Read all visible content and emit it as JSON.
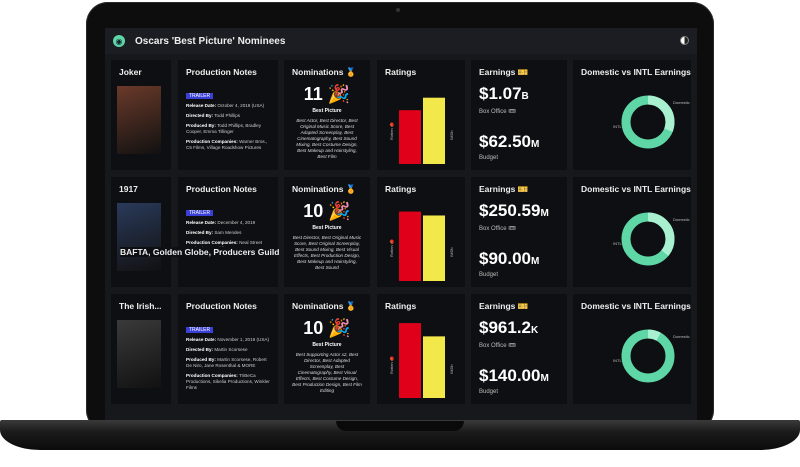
{
  "app": {
    "title": "Oscars 'Best Picture' Nominees"
  },
  "labels": {
    "production_notes": "Production Notes",
    "nominations": "Nominations 🏅",
    "ratings": "Ratings",
    "earnings": "Earnings 🎫",
    "domestic_vs_intl": "Domestic vs INTL Earnings",
    "trailer": "TRAILER",
    "box_office": "Box Office 🎟",
    "budget": "Budget",
    "release": "Release Date:",
    "directed": "Directed By:",
    "produced": "Produced By:",
    "companies": "Production Companies:",
    "rotten": "Rotten 🍅",
    "imdb": "IMDb",
    "domestic": "Domestic",
    "intl": "INTL"
  },
  "overlay": "BAFTA, Golden Globe, Producers Guild",
  "films": [
    {
      "title": "Joker",
      "release": "October 4, 2019 (USA)",
      "director": "Todd Phillips",
      "producers": "Todd Phillips, Bradley Cooper, Emma Tillinger",
      "companies": "Warner Bros., C5 Films, Village Roadshow Pictures",
      "nominations": "11 🎉",
      "win": "Best Picture",
      "nom_list": "Best Actor, Best Director, Best Original Music Score, Best Adapted Screenplay, Best Cinematography, Best Sound Mixing, Best Costume Design, Best Makeup and Hairstyling, Best Film",
      "box_office": "$1.07",
      "box_office_unit": "B",
      "budget": "$62.50",
      "budget_unit": "M",
      "rotten": 0.69,
      "imdb": 0.85,
      "domestic_share": 0.31,
      "poster": "#6a3a2a"
    },
    {
      "title": "1917",
      "release": "December 4, 2019",
      "director": "Sam Mendes",
      "producers": "",
      "companies": "Neal Street Productions, Amblin Partners & MORE",
      "nominations": "10 🎉",
      "win": "Best Picture",
      "nom_list": "Best Director, Best Original Music Score, Best Original Screenplay, Best Sound Mixing, Best Visual Effects, Best Production Design, Best Makeup and Hairstyling, Best Sound",
      "box_office": "$250.59",
      "box_office_unit": "M",
      "budget": "$90.00",
      "budget_unit": "M",
      "rotten": 0.89,
      "imdb": 0.84,
      "domestic_share": 0.36,
      "poster": "#2a3a5a"
    },
    {
      "title": "The Irish...",
      "release": "November 1, 2019 (USA)",
      "director": "Martin Scorsese",
      "producers": "Martin Scorsese, Robert De Niro, Jane Rosenthal & MORE",
      "companies": "TriBeCa Productions, Sikelia Productions, Winkler Films",
      "nominations": "10 🎉",
      "win": "Best Picture",
      "nom_list": "Best Supporting Actor x2, Best Director, Best Adapted Screenplay, Best Cinematography, Best Visual Effects, Best Costume Design, Best Production Design, Best Film Editing",
      "box_office": "$961.2",
      "box_office_unit": "K",
      "budget": "$140.00",
      "budget_unit": "M",
      "rotten": 0.96,
      "imdb": 0.79,
      "domestic_share": 0.08,
      "poster": "#3a3a3a"
    }
  ],
  "colors": {
    "accent": "#5fd6a6",
    "rotten": "#e0001a",
    "imdb": "#f3e84a",
    "trailer": "#3a3fd6"
  }
}
